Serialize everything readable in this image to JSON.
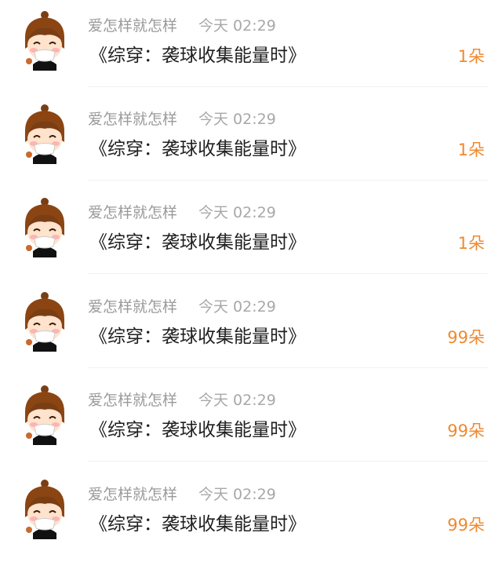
{
  "comments": [
    {
      "username": "爱怎样就怎样",
      "time": "今天 02:29",
      "text": "《综穿：袭球收集能量时》",
      "count": "1朵"
    },
    {
      "username": "爱怎样就怎样",
      "time": "今天 02:29",
      "text": "《综穿：袭球收集能量时》",
      "count": "1朵"
    },
    {
      "username": "爱怎样就怎样",
      "time": "今天 02:29",
      "text": "《综穿：袭球收集能量时》",
      "count": "1朵"
    },
    {
      "username": "爱怎样就怎样",
      "time": "今天 02:29",
      "text": "《综穿：袭球收集能量时》",
      "count": "99朵"
    },
    {
      "username": "爱怎样就怎样",
      "time": "今天 02:29",
      "text": "《综穿：袭球收集能量时》",
      "count": "99朵"
    },
    {
      "username": "爱怎样就怎样",
      "time": "今天 02:29",
      "text": "《综穿：袭球收集能量时》",
      "count": "99朵"
    }
  ],
  "colors": {
    "username": "#9a9a9a",
    "time": "#a8a8a8",
    "text": "#1f1f1f",
    "count": "#f0892f"
  },
  "icons": {
    "avatar": "cartoon-boy-avatar-icon"
  }
}
